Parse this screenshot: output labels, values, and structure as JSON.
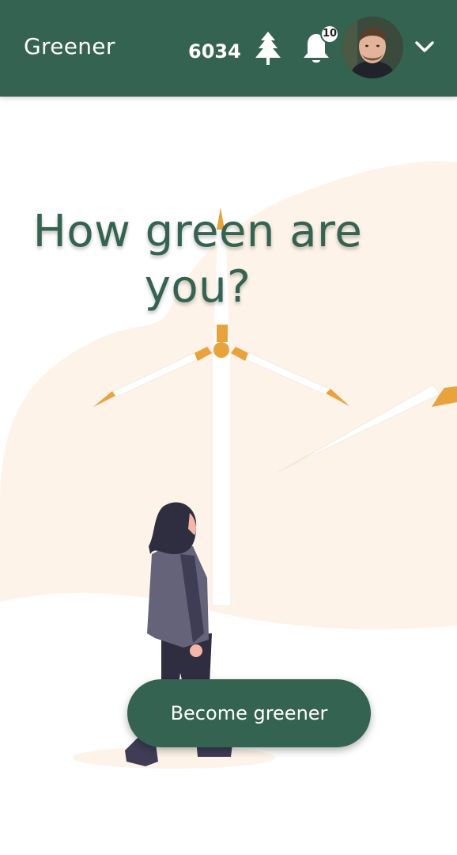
{
  "header": {
    "brand": "Greener",
    "points": "6034",
    "points_icon": "tree-icon",
    "notifications_icon": "bell-icon",
    "notifications_count": "10",
    "avatar_icon": "user-avatar",
    "menu_icon": "chevron-down-icon"
  },
  "hero": {
    "title_line1": "How green are",
    "title_line2": "you?",
    "cta_label": "Become greener"
  },
  "colors": {
    "primary": "#356351",
    "accent": "#e8a33d",
    "blob": "#fdf3e8",
    "figure_coat": "#65637a",
    "figure_dark": "#2f2e41"
  }
}
